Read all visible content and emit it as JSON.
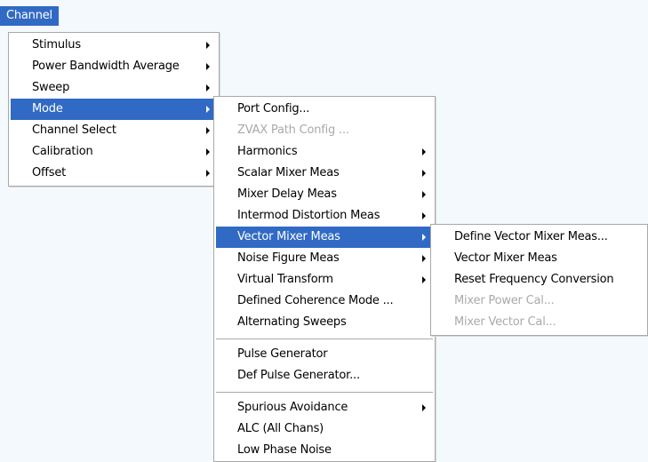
{
  "menubar": {
    "title": "Channel"
  },
  "channel_menu": {
    "items": [
      {
        "label": "Stimulus"
      },
      {
        "label": "Power Bandwidth Average"
      },
      {
        "label": "Sweep"
      },
      {
        "label": "Mode"
      },
      {
        "label": "Channel Select"
      },
      {
        "label": "Calibration"
      },
      {
        "label": "Offset"
      }
    ]
  },
  "mode_menu": {
    "items": [
      {
        "label": "Port Config..."
      },
      {
        "label": "ZVAX Path Config ..."
      },
      {
        "label": "Harmonics"
      },
      {
        "label": "Scalar Mixer Meas"
      },
      {
        "label": "Mixer Delay Meas"
      },
      {
        "label": "Intermod Distortion Meas"
      },
      {
        "label": "Vector Mixer Meas"
      },
      {
        "label": "Noise Figure Meas"
      },
      {
        "label": "Virtual Transform"
      },
      {
        "label": "Defined Coherence Mode ..."
      },
      {
        "label": "Alternating Sweeps"
      },
      {
        "label": "Pulse Generator"
      },
      {
        "label": "Def Pulse Generator..."
      },
      {
        "label": "Spurious Avoidance"
      },
      {
        "label": "ALC (All Chans)"
      },
      {
        "label": "Low Phase Noise"
      }
    ]
  },
  "vector_mixer_menu": {
    "items": [
      {
        "label": "Define Vector Mixer Meas..."
      },
      {
        "label": "Vector Mixer Meas"
      },
      {
        "label": "Reset Frequency Conversion"
      },
      {
        "label": "Mixer Power Cal..."
      },
      {
        "label": "Mixer Vector Cal..."
      }
    ]
  },
  "colors": {
    "highlight": "#316ac5",
    "disabled_text": "#aaaaaa",
    "background": "#f4f9fd"
  }
}
